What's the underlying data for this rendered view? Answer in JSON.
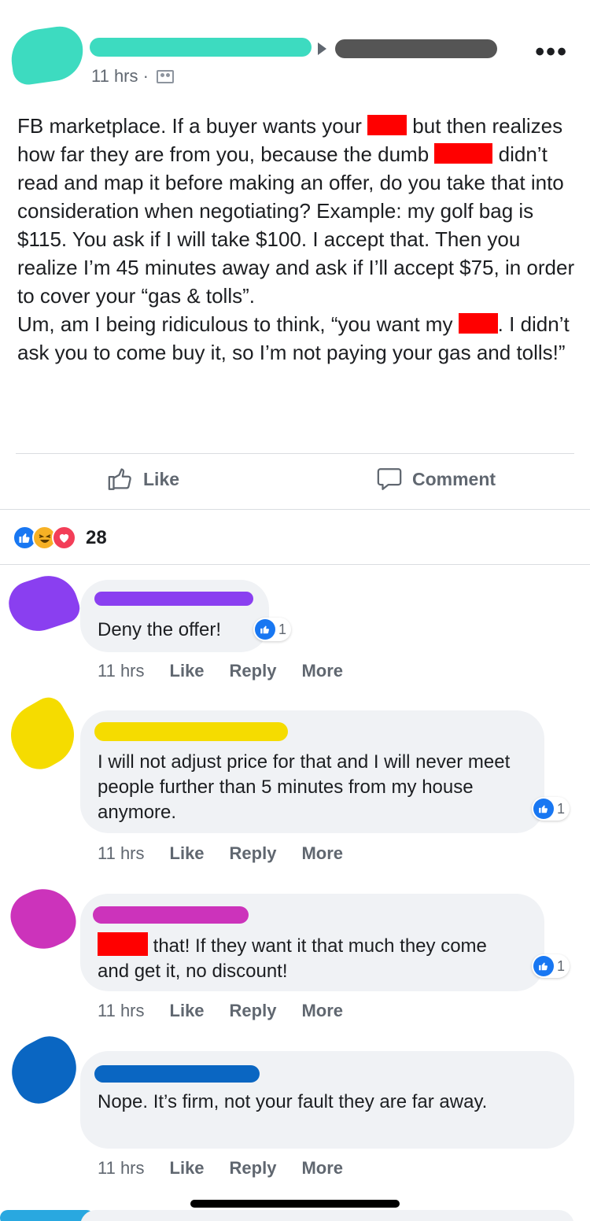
{
  "post": {
    "time": "11 hrs ·",
    "text_parts": {
      "p1": "FB marketplace. If a buyer wants your ",
      "p2": " but then realizes how far they are from you, because the dumb ",
      "p3": " didn’t read and map it before making an offer, do you take that into consideration when negotiating? Example: my golf bag is $115. You ask if I will take $100. I accept that. Then you realize I’m 45 minutes away and ask if I’ll accept $75, in order to cover your “gas & tolls”.",
      "p4": "Um, am I being ridiculous to think, “you want my ",
      "p5": ". I didn’t ask you to come buy it, so I’m not paying your gas and tolls!”"
    }
  },
  "actions": {
    "like_label": "Like",
    "comment_label": "Comment"
  },
  "reactions": {
    "count": "28",
    "icons": [
      "like-icon",
      "haha-icon",
      "love-icon"
    ]
  },
  "comments": [
    {
      "text": "Deny the offer!",
      "time": "11 hrs",
      "like": "Like",
      "reply": "Reply",
      "more": "More",
      "reaction_count": "1"
    },
    {
      "text": "I will not adjust price for that and I will never meet people further than 5 minutes from my house anymore.",
      "time": "11 hrs",
      "like": "Like",
      "reply": "Reply",
      "more": "More",
      "reaction_count": "1"
    },
    {
      "text": " that! If they want it that much they come and get it, no discount!",
      "time": "11 hrs",
      "like": "Like",
      "reply": "Reply",
      "more": "More",
      "reaction_count": "1"
    },
    {
      "text": "Nope. It’s firm, not your fault they are far away.",
      "time": "11 hrs",
      "like": "Like",
      "reply": "Reply",
      "more": "More"
    }
  ],
  "colors": {
    "fb_blue": "#1877f2",
    "redaction": "#ff0000",
    "scribble_post_author": "#3ddbc0",
    "scribble_group": "#555555",
    "scribble_c1": "#8a3ff0",
    "scribble_c2": "#f5dc00",
    "scribble_c3": "#cc33bb",
    "scribble_c4": "#0a66c2"
  }
}
